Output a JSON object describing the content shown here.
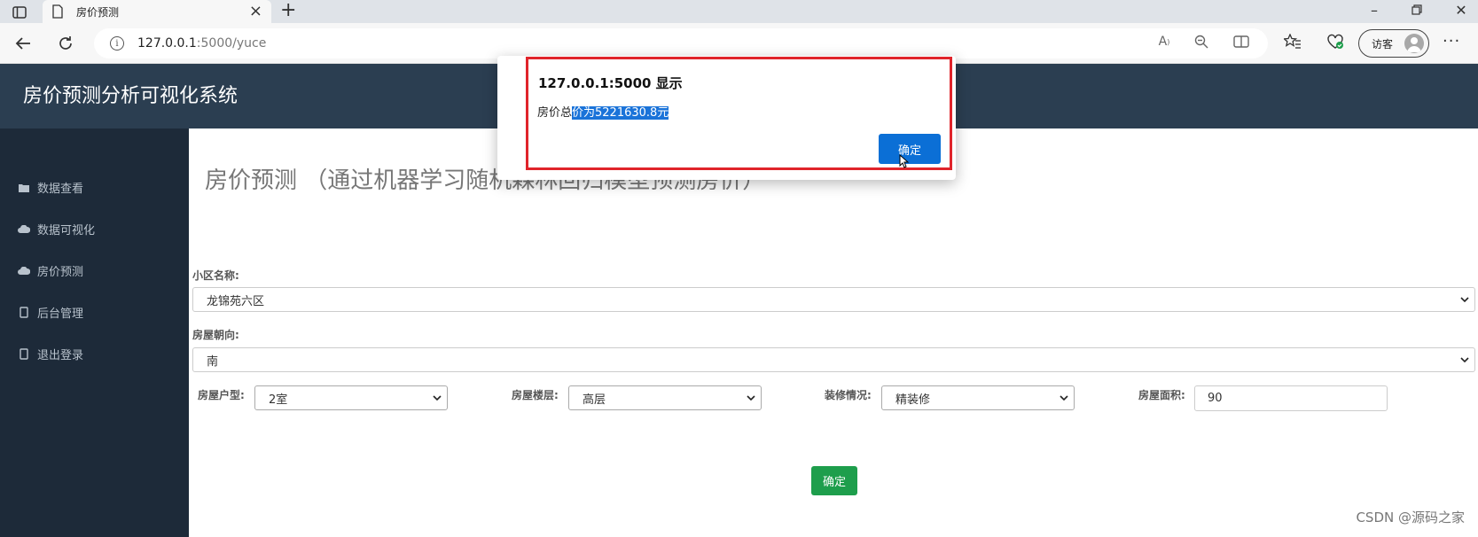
{
  "browser": {
    "tab_title": "房价预测",
    "url_host": "127.0.0.1",
    "url_path": ":5000/yuce",
    "guest_label": "访客"
  },
  "app": {
    "title": "房价预测分析可视化系统"
  },
  "sidebar": {
    "items": [
      {
        "label": "数据查看",
        "icon": "folder-icon"
      },
      {
        "label": "数据可视化",
        "icon": "cloud-icon"
      },
      {
        "label": "房价预测",
        "icon": "cloud-icon"
      },
      {
        "label": "后台管理",
        "icon": "tablet-icon"
      },
      {
        "label": "退出登录",
        "icon": "tablet-icon"
      }
    ]
  },
  "main": {
    "heading": "房价预测 （通过机器学习随机森林回归模型预测房价）",
    "community_label": "小区名称:",
    "community_value": "龙锦苑六区",
    "orientation_label": "房屋朝向:",
    "orientation_value": "南",
    "layout_label": "房屋户型:",
    "layout_value": "2室",
    "floor_label": "房屋楼层:",
    "floor_value": "高层",
    "decoration_label": "装修情况:",
    "decoration_value": "精装修",
    "area_label": "房屋面积:",
    "area_value": "90",
    "submit_label": "确定"
  },
  "alert": {
    "title": "127.0.0.1:5000 显示",
    "message_prefix": "房价总",
    "message_selected": "价为5221630.8元",
    "ok_label": "确定"
  },
  "watermark": "CSDN @源码之家"
}
